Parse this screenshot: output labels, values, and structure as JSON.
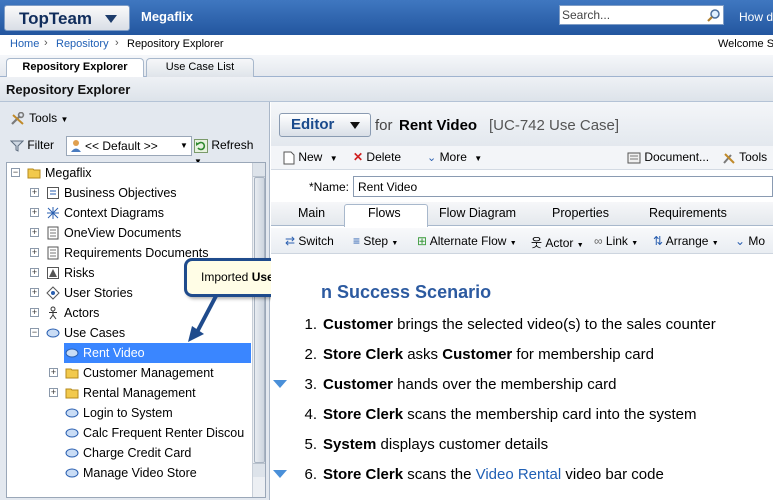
{
  "header": {
    "app_name": "TopTeam",
    "project_name": "Megaflix",
    "search_placeholder": "Search...",
    "help_text": "How do",
    "colors": {
      "topbar": "#2d64ad",
      "accent": "#1f5fb5"
    }
  },
  "breadcrumb": {
    "items": [
      "Home",
      "Repository",
      "Repository Explorer"
    ],
    "welcome": "Welcome  S"
  },
  "main_tabs": [
    "Repository Explorer",
    "Use Case List"
  ],
  "page_title": "Repository Explorer",
  "left_panel": {
    "tools_label": "Tools",
    "filter_label": "Filter",
    "default_view": "<< Default >>",
    "refresh_label": "Refresh",
    "tree": [
      {
        "label": "Megaflix",
        "icon": "folder-icon",
        "expander": "−"
      },
      {
        "label": "Business Objectives",
        "icon": "objectives-icon",
        "expander": "+"
      },
      {
        "label": "Context Diagrams",
        "icon": "diagram-icon",
        "expander": "+"
      },
      {
        "label": "OneView Documents",
        "icon": "document-icon",
        "expander": "+"
      },
      {
        "label": "Requirements Documents",
        "icon": "document-icon",
        "expander": "+"
      },
      {
        "label": "Risks",
        "icon": "risk-icon",
        "expander": "+"
      },
      {
        "label": "User Stories",
        "icon": "user-story-icon",
        "expander": "+"
      },
      {
        "label": "Actors",
        "icon": "actor-icon",
        "expander": "+"
      },
      {
        "label": "Use Cases",
        "icon": "use-case-icon",
        "expander": "−"
      },
      {
        "label": "Rent Video",
        "icon": "use-case-icon",
        "expander": ""
      },
      {
        "label": "Customer Management",
        "icon": "folder-icon",
        "expander": "+"
      },
      {
        "label": "Rental Management",
        "icon": "folder-icon",
        "expander": "+"
      },
      {
        "label": "Login to System",
        "icon": "use-case-icon",
        "expander": ""
      },
      {
        "label": "Calc Frequent Renter Discou",
        "icon": "use-case-icon",
        "expander": ""
      },
      {
        "label": "Charge Credit Card",
        "icon": "use-case-icon",
        "expander": ""
      },
      {
        "label": "Manage Video Store",
        "icon": "use-case-icon",
        "expander": ""
      }
    ]
  },
  "callout": {
    "prefix": "Imported ",
    "bold": "Use Case"
  },
  "editor": {
    "mode_label": "Editor",
    "for_text": "for",
    "item_name": "Rent Video",
    "item_id": "[UC-742 Use Case]",
    "toolbar": {
      "new": "New",
      "delete": "Delete",
      "more": "More",
      "document": "Document...",
      "tools": "Tools"
    },
    "name_label": "*Name:",
    "name_value": "Rent Video",
    "tabs": [
      "Main",
      "Flows",
      "Flow Diagram",
      "Properties",
      "Requirements"
    ],
    "flow_toolbar": [
      "Switch",
      "Step",
      "Alternate Flow",
      "Actor",
      "Link",
      "Arrange",
      "Mo"
    ],
    "scenario_title": "n Success Scenario",
    "steps": [
      {
        "num": "1.",
        "parts": [
          [
            "b",
            "Customer"
          ],
          [
            "t",
            " brings the selected video(s) to the sales counter"
          ]
        ],
        "marker": false
      },
      {
        "num": "2.",
        "parts": [
          [
            "b",
            "Store Clerk"
          ],
          [
            "t",
            " asks "
          ],
          [
            "b",
            "Customer"
          ],
          [
            "t",
            " for membership card"
          ]
        ],
        "marker": false
      },
      {
        "num": "3.",
        "parts": [
          [
            "b",
            "Customer"
          ],
          [
            "t",
            " hands over the membership card"
          ]
        ],
        "marker": true
      },
      {
        "num": "4.",
        "parts": [
          [
            "b",
            "Store Clerk"
          ],
          [
            "t",
            " scans the membership card into the system"
          ]
        ],
        "marker": false
      },
      {
        "num": "5.",
        "parts": [
          [
            "b",
            "System"
          ],
          [
            "t",
            " displays customer details"
          ]
        ],
        "marker": false
      },
      {
        "num": "6.",
        "parts": [
          [
            "b",
            "Store Clerk"
          ],
          [
            "t",
            " scans the "
          ],
          [
            "l",
            "Video Rental"
          ],
          [
            "t",
            " video bar code"
          ]
        ],
        "marker": true
      }
    ]
  }
}
